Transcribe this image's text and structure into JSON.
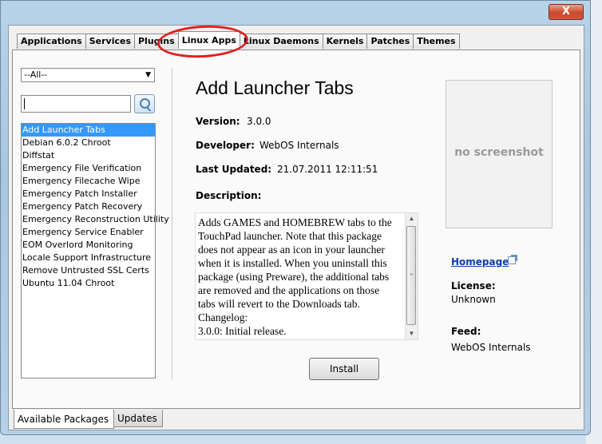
{
  "window": {
    "close_label": "X"
  },
  "top_tabs": [
    {
      "label": "Applications"
    },
    {
      "label": "Services"
    },
    {
      "label": "Plugins"
    },
    {
      "label": "Linux Apps"
    },
    {
      "label": "Linux Daemons"
    },
    {
      "label": "Kernels"
    },
    {
      "label": "Patches"
    },
    {
      "label": "Themes"
    }
  ],
  "active_tab_index": 3,
  "filter": {
    "selected": "--All--"
  },
  "search": {
    "value": ""
  },
  "packages": [
    "Add Launcher Tabs",
    "Debian 6.0.2 Chroot",
    "Diffstat",
    "Emergency File Verification",
    "Emergency Filecache Wipe",
    "Emergency Patch Installer",
    "Emergency Patch Recovery",
    "Emergency Reconstruction Utility",
    "Emergency Service Enabler",
    "EOM Overlord Monitoring",
    "Locale Support Infrastructure",
    "Remove Untrusted SSL Certs",
    "Ubuntu 11.04 Chroot"
  ],
  "selected_package_index": 0,
  "detail": {
    "title": "Add Launcher Tabs",
    "version_label": "Version:",
    "version": "3.0.0",
    "developer_label": "Developer:",
    "developer": "WebOS Internals",
    "updated_label": "Last Updated:",
    "updated": "21.07.2011 12:11:51",
    "description_label": "Description:",
    "description_lines": [
      "Adds GAMES and HOMEBREW tabs to the",
      "TouchPad launcher. Note that this package",
      "does not appear as an icon in your launcher",
      "when it is installed. When you uninstall this",
      "package (using Preware), the additional tabs",
      "are removed and the applications on those",
      "tabs will revert to the Downloads tab.",
      "Changelog:",
      "3.0.0: Initial release."
    ],
    "install_label": "Install",
    "screenshot_placeholder": "no screenshot",
    "homepage_label": "Homepage",
    "license_label": "License:",
    "license": "Unknown",
    "feed_label": "Feed:",
    "feed": "WebOS Internals"
  },
  "bottom_tabs": [
    {
      "label": "Available Packages"
    },
    {
      "label": "Updates"
    }
  ],
  "colors": {
    "selection": "#3399ff",
    "annotation_circle": "#e02020",
    "link": "#0b3ea8"
  }
}
